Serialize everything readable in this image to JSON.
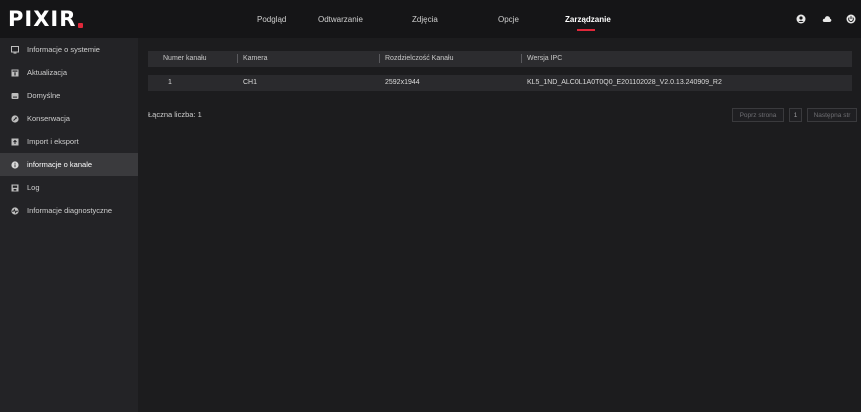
{
  "app": {
    "logo": "PIXIR"
  },
  "nav": {
    "items": [
      {
        "label": "Podgląd"
      },
      {
        "label": "Odtwarzanie"
      },
      {
        "label": "Zdjęcia"
      },
      {
        "label": "Opcje"
      },
      {
        "label": "Zarządzanie"
      }
    ],
    "active_index": 4,
    "icons": [
      "user-icon",
      "cloud-icon",
      "power-icon"
    ]
  },
  "sidebar": {
    "items": [
      {
        "label": "Informacje o systemie",
        "icon": "monitor-icon"
      },
      {
        "label": "Aktualizacja",
        "icon": "upgrade-icon"
      },
      {
        "label": "Domyślne",
        "icon": "default-icon"
      },
      {
        "label": "Konserwacja",
        "icon": "maintenance-icon"
      },
      {
        "label": "Import i eksport",
        "icon": "import-export-icon"
      },
      {
        "label": "informacje o kanale",
        "icon": "info-icon"
      },
      {
        "label": "Log",
        "icon": "log-icon"
      },
      {
        "label": "Informacje diagnostyczne",
        "icon": "diagnostics-icon"
      }
    ],
    "active_index": 5
  },
  "table": {
    "headers": [
      "Numer kanału",
      "Kamera",
      "Rozdzielczość Kanału",
      "Wersja IPC"
    ],
    "rows": [
      [
        "1",
        "CH1",
        "2592x1944",
        "KL5_1ND_ALC0L1A0T0Q0_E201102028_V2.0.13.240909_R2"
      ]
    ]
  },
  "footer": {
    "total": "Łączna liczba: 1",
    "prev_label": "Poprz strona",
    "page": "1",
    "next_label": "Następna str"
  },
  "colors": {
    "accent": "#e0283a",
    "background": "#1c1c1e",
    "sidebar": "#232326",
    "topbar": "#151517"
  }
}
